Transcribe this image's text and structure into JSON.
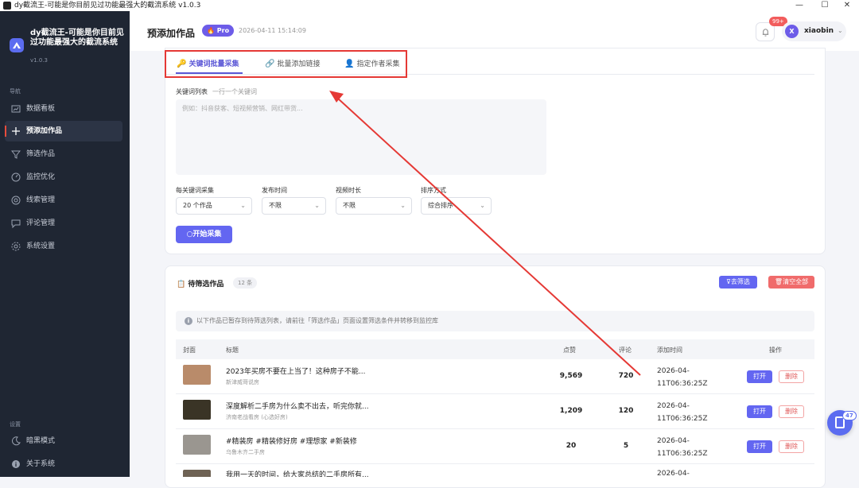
{
  "window": {
    "title": "dy截流王-可能是你目前见过功能最强大的截流系统 v1.0.3",
    "minimize": "—",
    "maximize": "☐",
    "close": "✕"
  },
  "brand": {
    "name": "dy截流王-可能是你目前见过功能最强大的截流系统",
    "version": "v1.0.3"
  },
  "sidebar": {
    "nav_label": "导航",
    "items": [
      {
        "label": "数据看板",
        "icon": "chart-icon"
      },
      {
        "label": "预添加作品",
        "icon": "plus-icon"
      },
      {
        "label": "筛选作品",
        "icon": "filter-icon"
      },
      {
        "label": "监控优化",
        "icon": "gauge-icon"
      },
      {
        "label": "线索管理",
        "icon": "target-icon"
      },
      {
        "label": "评论管理",
        "icon": "comment-icon"
      },
      {
        "label": "系统设置",
        "icon": "gear-icon"
      }
    ],
    "settings_label": "设置",
    "bottom_items": [
      {
        "label": "暗黑模式",
        "icon": "moon-icon"
      },
      {
        "label": "关于系统",
        "icon": "info-icon"
      }
    ]
  },
  "header": {
    "title": "预添加作品",
    "badge": "Pro",
    "timestamp": "2026-04-11 15:14:09",
    "notif_count": "99+",
    "user": {
      "initial": "X",
      "name": "xiaobin"
    }
  },
  "tabs": [
    {
      "label": "关键词批量采集",
      "icon": "🔑"
    },
    {
      "label": "批量添加链接",
      "icon": "🔗"
    },
    {
      "label": "指定作者采集",
      "icon": "👤"
    }
  ],
  "form": {
    "keyword_label": "关键词列表",
    "keyword_hint": "一行一个关键词",
    "keyword_placeholder": "例如：抖音获客、短视频营销、网红带货...",
    "per_keyword_label": "每关键词采集",
    "per_keyword_value": "20 个作品",
    "publish_time_label": "发布时间",
    "publish_time_value": "不限",
    "duration_label": "视频时长",
    "duration_value": "不限",
    "sort_label": "排序方式",
    "sort_value": "综合排序",
    "start_button": "开始采集"
  },
  "pending": {
    "title": "待筛选作品",
    "count": "12 条",
    "filter_button": "去筛选",
    "clear_button": "清空全部",
    "info": "以下作品已暂存到待筛选列表，请前往「筛选作品」页面设置筛选条件并转移到监控库",
    "columns": [
      "封面",
      "标题",
      "点赞",
      "评论",
      "添加时间",
      "操作"
    ],
    "rows": [
      {
        "title": "2023年买房不要在上当了！这种房子不能...",
        "author": "新津威哥说房",
        "likes": "9,569",
        "comments": "720",
        "time1": "2026-04-",
        "time2": "11T06:36:25Z",
        "thumb": "#b98b6a"
      },
      {
        "title": "深度解析二手房为什么卖不出去，听完你就...",
        "author": "济南老战看房  (心选好房)",
        "likes": "1,209",
        "comments": "120",
        "time1": "2026-04-",
        "time2": "11T06:36:25Z",
        "thumb": "#3a3426"
      },
      {
        "title": "#精装房 #精装修好房 #理想家 #新装修",
        "author": "乌鲁木齐二手房",
        "likes": "20",
        "comments": "5",
        "time1": "2026-04-",
        "time2": "11T06:36:25Z",
        "thumb": "#9a9690"
      },
      {
        "title": "我用一天的时间，给大家总结的二手房所有...",
        "author": "",
        "likes": "",
        "comments": "",
        "time1": "2026-04-",
        "time2": "",
        "thumb": "#6e6254"
      }
    ],
    "open_label": "打开",
    "delete_label": "删除"
  },
  "float_badge": "47"
}
